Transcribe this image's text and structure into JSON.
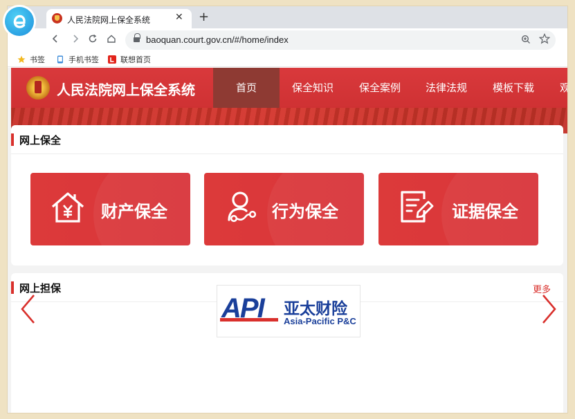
{
  "browser": {
    "tab_title": "人民法院网上保全系统",
    "close_glyph": "✕",
    "new_tab_glyph": "+",
    "url": "baoquan.court.gov.cn/#/home/index",
    "bookmarks": [
      {
        "label": "书签",
        "icon": "star-icon"
      },
      {
        "label": "手机书签",
        "icon": "phone-icon"
      },
      {
        "label": "联想首页",
        "icon": "lenovo-icon"
      }
    ]
  },
  "site": {
    "title": "人民法院网上保全系统",
    "nav": [
      "首页",
      "保全知识",
      "保全案例",
      "法律法规",
      "模板下载",
      "观"
    ],
    "active_nav": "首页"
  },
  "online_preservation": {
    "title": "网上保全",
    "cards": [
      {
        "label": "财产保全",
        "icon": "house-yen-icon"
      },
      {
        "label": "行为保全",
        "icon": "person-action-icon"
      },
      {
        "label": "证据保全",
        "icon": "document-edit-icon"
      }
    ]
  },
  "online_guarantee": {
    "title": "网上担保",
    "more": "更多",
    "partner": {
      "abbr": "API",
      "cn_name": "亚太财险",
      "en_name": "Asia-Pacific P&C"
    }
  },
  "colors": {
    "brand_red": "#d9302c",
    "nav_active": "#8e3a33",
    "logo_blue": "#1a3f9a"
  }
}
